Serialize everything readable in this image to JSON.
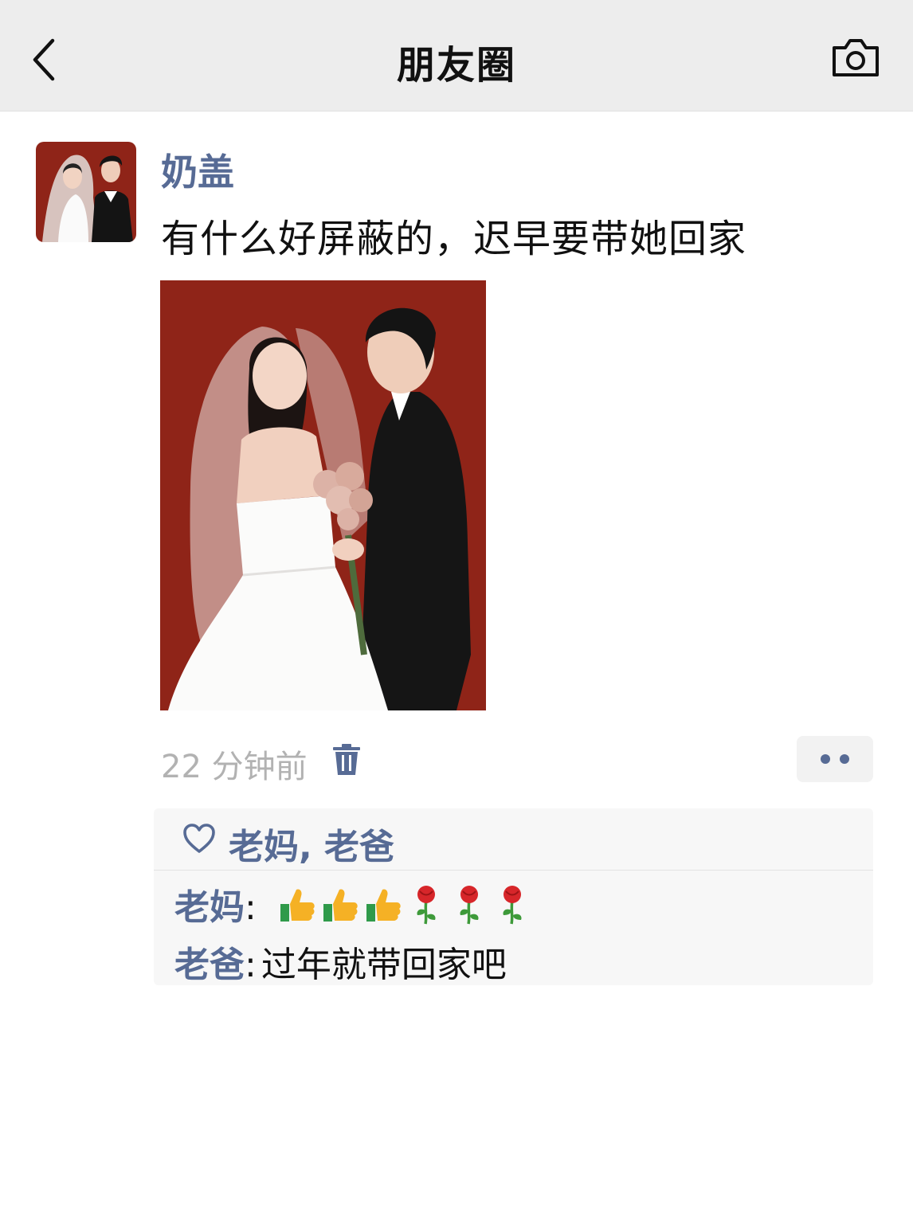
{
  "navbar": {
    "title": "朋友圈",
    "back_icon": "chevron-left-icon",
    "camera_icon": "camera-icon"
  },
  "post": {
    "author": "奶盖",
    "text": "有什么好屏蔽的，迟早要带她回家",
    "time": "22 分钟前",
    "delete_icon": "trash-icon",
    "more_icon": "more-dots-icon"
  },
  "likes": {
    "icon": "heart-outline-icon",
    "names": "老妈, 老爸"
  },
  "comments": [
    {
      "author": "老妈",
      "separator": ":",
      "emojis": [
        "thumbs-up-icon",
        "thumbs-up-icon",
        "thumbs-up-icon",
        "rose-icon",
        "rose-icon",
        "rose-icon"
      ]
    },
    {
      "author": "老爸",
      "separator": ":",
      "text": "过年就带回家吧"
    }
  ],
  "colors": {
    "link": "#576b95",
    "nav_bg": "#ededed",
    "photo_bg": "#8f2418",
    "panel_bg": "#f7f7f7",
    "time": "#b2b2b2"
  }
}
